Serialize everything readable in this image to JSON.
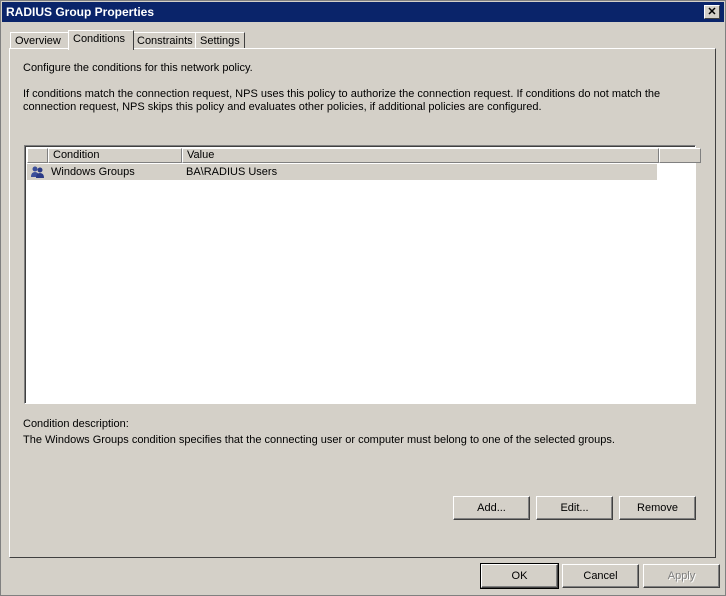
{
  "window": {
    "title": "RADIUS Group Properties",
    "close_glyph": "✕"
  },
  "tabs": [
    {
      "label": "Overview"
    },
    {
      "label": "Conditions"
    },
    {
      "label": "Constraints"
    },
    {
      "label": "Settings"
    }
  ],
  "conditions": {
    "intro": "Configure the conditions for this network policy.",
    "explanation_line1": "If conditions match the connection request, NPS uses this policy to authorize the connection request. If conditions do not match the",
    "explanation_line2": "connection request, NPS skips this policy and evaluates other policies, if additional policies are configured.",
    "columns": {
      "condition": "Condition",
      "value": "Value"
    },
    "rows": [
      {
        "icon": "user-group-icon",
        "condition": "Windows Groups",
        "value": "BA\\RADIUS Users"
      }
    ],
    "description_label": "Condition description:",
    "description_text": "The Windows Groups condition specifies that the connecting user or computer must belong to one of the selected groups.",
    "buttons": {
      "add": "Add...",
      "edit": "Edit...",
      "remove": "Remove"
    }
  },
  "footer": {
    "ok": "OK",
    "cancel": "Cancel",
    "apply": "Apply"
  },
  "colors": {
    "titlebar": "#0a246a",
    "face": "#d4d0c8"
  }
}
